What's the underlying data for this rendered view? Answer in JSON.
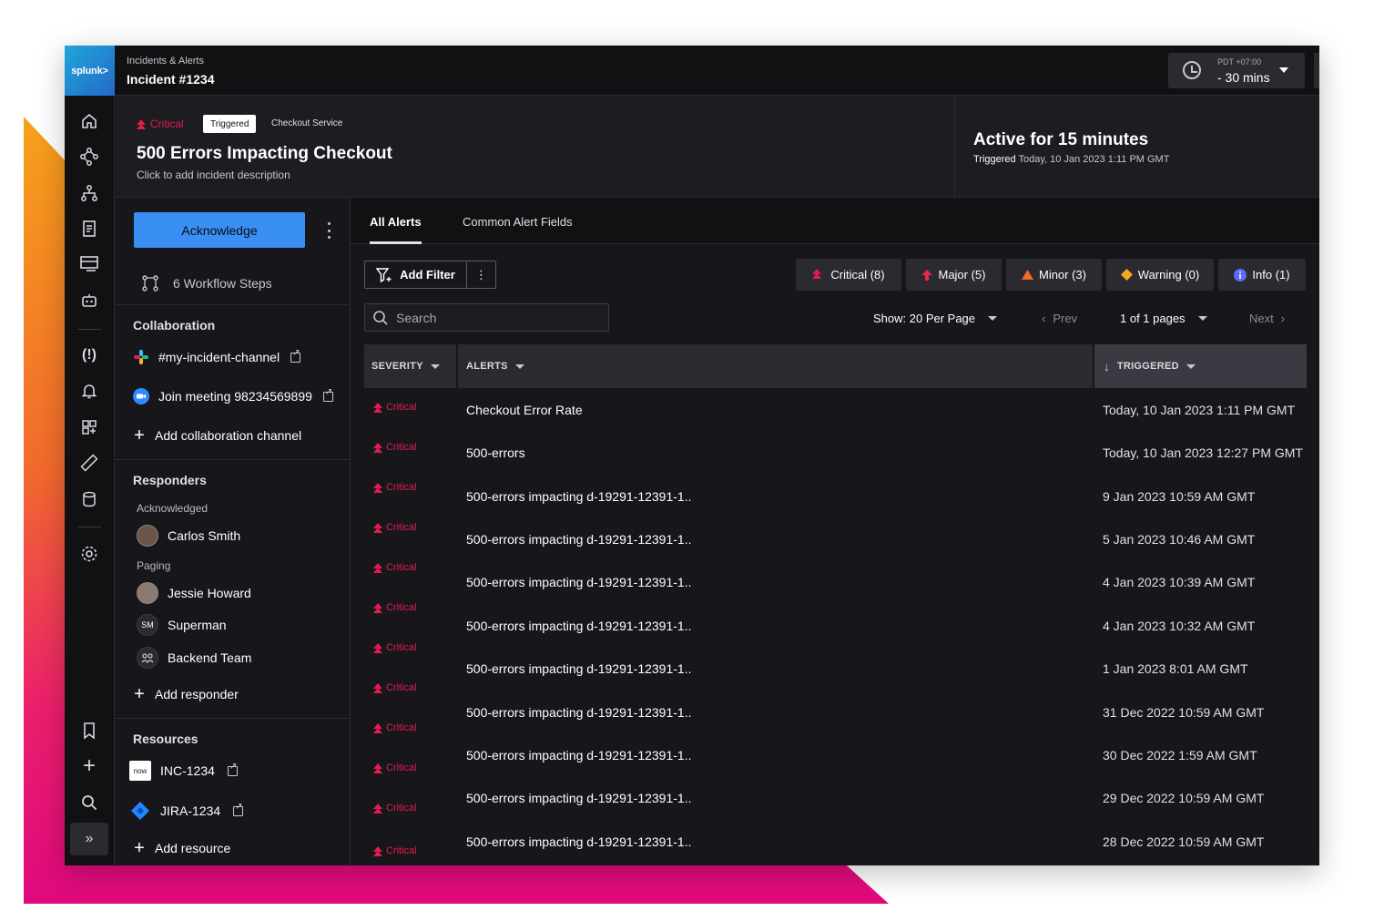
{
  "app": {
    "logo_text": "splunk>",
    "breadcrumb": "Incidents & Alerts",
    "title": "Incident #1234",
    "time_zone": "PDT +07:00",
    "time_range": "- 30 mins"
  },
  "incident": {
    "severity": "Critical",
    "status": "Triggered",
    "service": "Checkout Service",
    "title": "500 Errors Impacting Checkout",
    "description_placeholder": "Click to add incident description",
    "active_for": "Active for 15 minutes",
    "triggered_label": "Triggered",
    "triggered_time": "Today, 10 Jan 2023 1:11 PM GMT"
  },
  "left": {
    "acknowledge": "Acknowledge",
    "workflow_steps": "6 Workflow Steps",
    "collaboration": {
      "title": "Collaboration",
      "channel": "#my-incident-channel",
      "meeting": "Join meeting 98234569899",
      "add": "Add collaboration channel"
    },
    "responders": {
      "title": "Responders",
      "acknowledged_label": "Acknowledged",
      "acknowledged": [
        "Carlos Smith"
      ],
      "paging_label": "Paging",
      "paging": [
        "Jessie Howard",
        "Superman",
        "Backend Team"
      ],
      "superman_initials": "SM",
      "add": "Add responder"
    },
    "resources": {
      "title": "Resources",
      "items": [
        "INC-1234",
        "JIRA-1234"
      ],
      "now_logo": "now",
      "add": "Add resource"
    }
  },
  "tabs": [
    "All Alerts",
    "Common Alert Fields"
  ],
  "filters": {
    "add_filter": "Add Filter",
    "chips": [
      "Critical (8)",
      "Major (5)",
      "Minor (3)",
      "Warning (0)",
      "Info (1)"
    ],
    "search_placeholder": "Search",
    "per_page": "Show: 20 Per Page",
    "prev": "Prev",
    "pages": "1 of 1 pages",
    "next": "Next"
  },
  "table": {
    "headers": [
      "SEVERITY",
      "ALERTS",
      "TRIGGERED"
    ],
    "rows": [
      {
        "severity": "Critical",
        "alert": "Checkout Error Rate",
        "triggered": "Today, 10 Jan 2023 1:11 PM GMT"
      },
      {
        "severity": "Critical",
        "alert": "500-errors",
        "triggered": "Today, 10 Jan 2023 12:27 PM GMT"
      },
      {
        "severity": "Critical",
        "alert": "500-errors impacting d-19291-12391-1..",
        "triggered": "9 Jan 2023 10:59 AM GMT"
      },
      {
        "severity": "Critical",
        "alert": "500-errors impacting d-19291-12391-1..",
        "triggered": "5 Jan 2023 10:46 AM GMT"
      },
      {
        "severity": "Critical",
        "alert": "500-errors impacting d-19291-12391-1..",
        "triggered": "4 Jan 2023 10:39 AM GMT"
      },
      {
        "severity": "Critical",
        "alert": "500-errors impacting d-19291-12391-1..",
        "triggered": "4 Jan 2023 10:32 AM GMT"
      },
      {
        "severity": "Critical",
        "alert": "500-errors impacting d-19291-12391-1..",
        "triggered": "1 Jan 2023 8:01 AM GMT"
      },
      {
        "severity": "Critical",
        "alert": "500-errors impacting d-19291-12391-1..",
        "triggered": "31 Dec 2022 10:59 AM GMT"
      },
      {
        "severity": "Critical",
        "alert": "500-errors impacting d-19291-12391-1..",
        "triggered": "30 Dec 2022 1:59 AM GMT"
      },
      {
        "severity": "Critical",
        "alert": "500-errors impacting d-19291-12391-1..",
        "triggered": "29 Dec 2022 10:59 AM GMT"
      },
      {
        "severity": "Critical",
        "alert": "500-errors impacting d-19291-12391-1..",
        "triggered": "28 Dec 2022 10:59 AM GMT"
      }
    ],
    "last_row_severity": "Critical"
  },
  "colors": {
    "critical": "#e21c4f",
    "major": "#e8294a",
    "minor": "#f26a2d",
    "warning": "#f5a623",
    "info": "#5b6cf5",
    "primary": "#3a8ff5"
  },
  "icons": {
    "nav": [
      "home-icon",
      "topology-icon",
      "hierarchy-icon",
      "document-icon",
      "server-icon",
      "robot-icon",
      "alert-icon",
      "bell-icon",
      "dashboard-icon",
      "ruler-icon",
      "database-icon",
      "gear-icon",
      "bookmark-icon",
      "plus-icon",
      "search-icon",
      "expand-icon"
    ]
  }
}
